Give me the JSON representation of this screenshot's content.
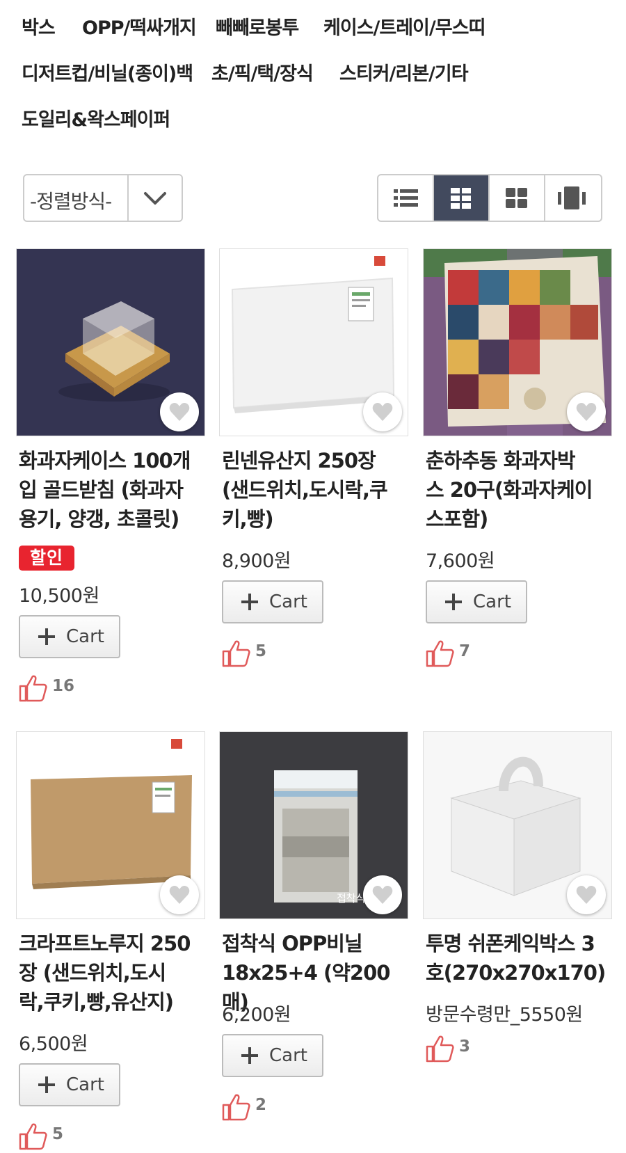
{
  "categories": [
    "박스",
    "OPP/떡싸개지",
    "빼빼로봉투",
    "케이스/트레이/무스띠",
    "디저트컵/비닐(종이)백",
    "초/픽/택/장식",
    "스티커/리본/기타",
    "도일리&왁스페이퍼"
  ],
  "sort": {
    "label": "-정렬방식-"
  },
  "view_modes": [
    "list-view-icon",
    "grid-view-icon",
    "large-grid-icon",
    "gallery-view-icon"
  ],
  "colors": {
    "active_view": "#424a5e",
    "badge": "#e8242f",
    "like_icon": "#e05a5a"
  },
  "cart_label": "Cart",
  "products": [
    {
      "title_lines": [
        "화과자케이스 100개",
        "입 골드받침 (화과자",
        "용기, 양갱, 초콜릿)"
      ],
      "badge": "할인",
      "price": "10,500원",
      "cart": true,
      "likes": "16",
      "image": "gold-case-photo"
    },
    {
      "title_lines": [
        "린넨유산지 250장",
        "(샌드위치,도시락,쿠",
        "키,빵)"
      ],
      "badge": "",
      "price": "8,900원",
      "cart": true,
      "likes": "5",
      "image": "linen-paper-photo"
    },
    {
      "title_lines": [
        "춘하추동 화과자박",
        "스 20구(화과자케이",
        "스포함)"
      ],
      "badge": "",
      "price": "7,600원",
      "cart": true,
      "likes": "7",
      "image": "patchwork-box-photo"
    },
    {
      "title_lines": [
        "크라프트노루지 250",
        "장 (샌드위치,도시",
        "락,쿠키,빵,유산지)"
      ],
      "badge": "",
      "price": "6,500원",
      "cart": true,
      "likes": "5",
      "image": "kraft-paper-photo"
    },
    {
      "title_lines": [
        "접착식 OPP비닐",
        "18x25+4 (약200매)"
      ],
      "badge": "",
      "price": "6,200원",
      "cart": true,
      "likes": "2",
      "image": "opp-bag-photo",
      "image_caption": "접착식"
    },
    {
      "title_lines": [
        "투명 쉬폰케익박스 3",
        "호(270x270x170)"
      ],
      "badge": "",
      "price": "방문수령만_5550원",
      "cart": false,
      "likes": "3",
      "image": "clear-cake-box-photo"
    }
  ]
}
